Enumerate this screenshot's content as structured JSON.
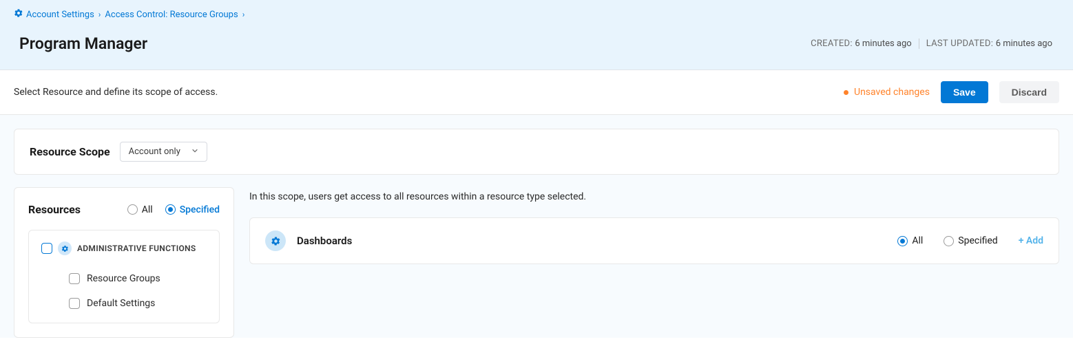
{
  "breadcrumb": {
    "item1": "Account Settings",
    "item2": "Access Control: Resource Groups"
  },
  "page_title": "Program Manager",
  "meta": {
    "created_label": "CREATED: ",
    "created_value": "6 minutes ago",
    "updated_label": "LAST UPDATED: ",
    "updated_value": "6 minutes ago"
  },
  "action_bar": {
    "description": "Select Resource and define its scope of access.",
    "unsaved": "Unsaved changes",
    "save": "Save",
    "discard": "Discard"
  },
  "scope": {
    "title": "Resource Scope",
    "selected": "Account only"
  },
  "resources_panel": {
    "title": "Resources",
    "option_all": "All",
    "option_specified": "Specified",
    "group_label": "ADMINISTRATIVE FUNCTIONS",
    "children": {
      "0": "Resource Groups",
      "1": "Default Settings"
    }
  },
  "right_panel": {
    "description": "In this scope, users get access to all resources within a resource type selected.",
    "row": {
      "name": "Dashboards",
      "option_all": "All",
      "option_specified": "Specified",
      "add": "+ Add"
    }
  }
}
